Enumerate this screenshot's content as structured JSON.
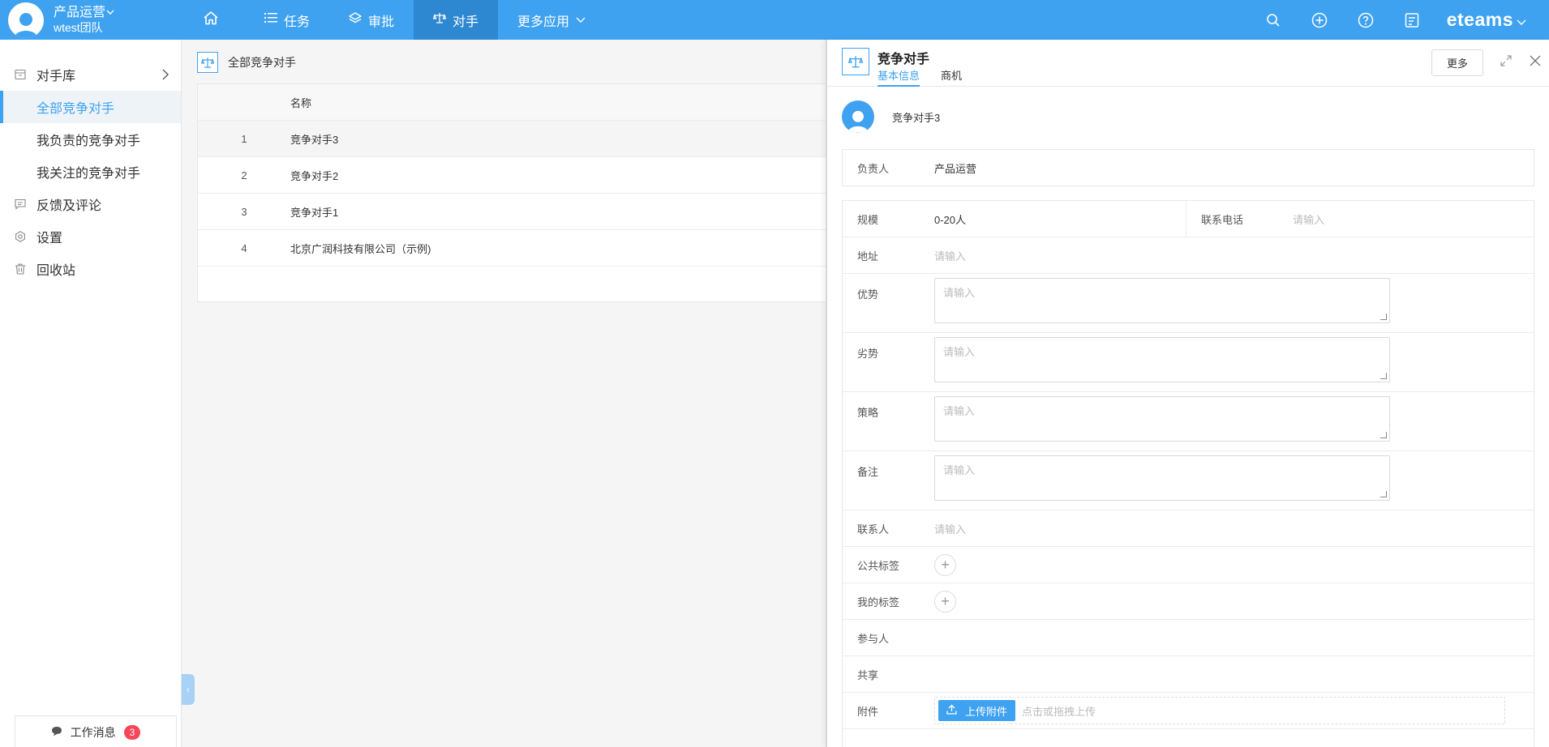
{
  "header": {
    "user_name": "产品运营",
    "team": "wtest团队",
    "nav": [
      {
        "label": "任务"
      },
      {
        "label": "审批"
      },
      {
        "label": "对手"
      },
      {
        "label": "更多应用"
      }
    ],
    "brand": "eteams",
    "accent": "#3fa2f0"
  },
  "sidebar": {
    "group_label": "对手库",
    "items": [
      {
        "label": "全部竞争对手"
      },
      {
        "label": "我负责的竞争对手"
      },
      {
        "label": "我关注的竞争对手"
      }
    ],
    "feedback": "反馈及评论",
    "settings": "设置",
    "recycle": "回收站",
    "work_msg": "工作消息",
    "work_msg_count": "3"
  },
  "main": {
    "breadcrumb": "全部竞争对手",
    "column_name": "名称",
    "rows": [
      {
        "idx": "1",
        "name": "竞争对手3"
      },
      {
        "idx": "2",
        "name": "竞争对手2"
      },
      {
        "idx": "3",
        "name": "竞争对手1"
      },
      {
        "idx": "4",
        "name": "北京广润科技有限公司（示例)"
      }
    ]
  },
  "panel": {
    "title": "竞争对手",
    "tabs": [
      {
        "label": "基本信息"
      },
      {
        "label": "商机"
      }
    ],
    "more": "更多",
    "record_name": "竞争对手3",
    "owner_label": "负责人",
    "owner_value": "产品运营",
    "scale_label": "规模",
    "scale_value": "0-20人",
    "phone_label": "联系电话",
    "placeholder": "请输入",
    "address_label": "地址",
    "advantage_label": "优势",
    "disadvantage_label": "劣势",
    "strategy_label": "策略",
    "remark_label": "备注",
    "contact_label": "联系人",
    "public_tag_label": "公共标签",
    "my_tag_label": "我的标签",
    "participant_label": "参与人",
    "share_label": "共享",
    "attachment_label": "附件",
    "upload_label": "上传附件",
    "upload_hint": "点击或拖拽上传"
  }
}
